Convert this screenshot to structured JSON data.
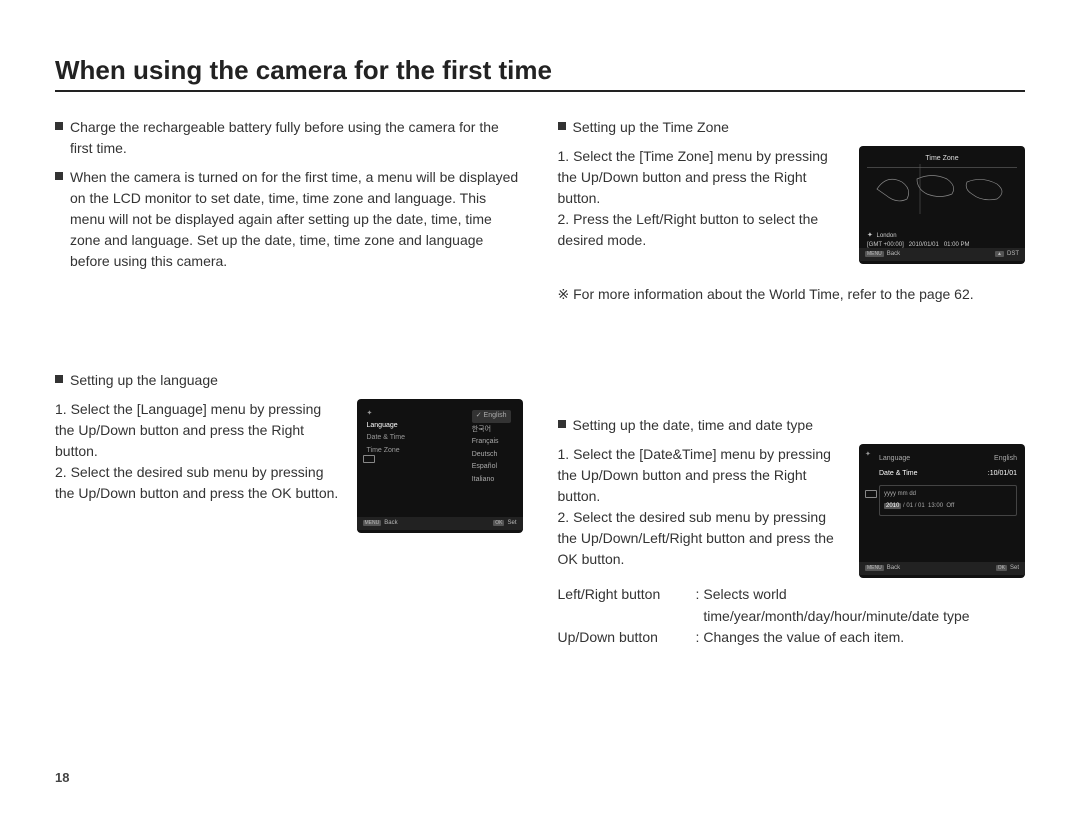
{
  "title": "When using the camera for the first time",
  "pageNumber": "18",
  "left": {
    "bullet1": "Charge the rechargeable battery fully before using the camera for the first time.",
    "bullet2": "When the camera is turned on for the first time, a menu will be displayed on the LCD monitor to set date, time, time zone and language. This menu will not be displayed again after setting up the date, time, time zone and language. Set up the date, time, time zone and language before using this camera.",
    "langSection": {
      "heading": "Setting up the language",
      "step1": "1. Select the [Language] menu by pressing the Up/Down button and press the Right button.",
      "step2": "2. Select the desired sub menu by pressing the Up/Down button and press the OK button.",
      "screen": {
        "menuItems": [
          "Language",
          "Date & Time",
          "Time Zone"
        ],
        "options": [
          "English",
          "한국어",
          "Français",
          "Deutsch",
          "Español",
          "Italiano"
        ],
        "footerLeft": "Back",
        "footerLeftBtn": "MENU",
        "footerRight": "Set",
        "footerRightBtn": "OK"
      }
    }
  },
  "right": {
    "tzSection": {
      "heading": "Setting up the Time Zone",
      "step1": "1. Select the [Time Zone] menu by pressing the Up/Down button and press the Right button.",
      "step2": "2. Press the Left/Right button to select the desired mode.",
      "screen": {
        "title": "Time Zone",
        "city": "London",
        "gmt": "[GMT +00:00]",
        "date": "2010/01/01",
        "time": "01:00 PM",
        "footerLeft": "Back",
        "footerLeftBtn": "MENU",
        "footerRight": "DST"
      },
      "note": "※ For more information about the World Time, refer to the page 62."
    },
    "dtSection": {
      "heading": "Setting up the date, time and date type",
      "step1": "1. Select the [Date&Time] menu by pressing the Up/Down button and press the Right button.",
      "step2": "2. Select the desired sub menu by pressing the Up/Down/Left/Right button and press the OK button.",
      "screen": {
        "row1Label": "Language",
        "row1Value": "English",
        "row2Label": "Date & Time",
        "row2Value": ":10/01/01",
        "format": "yyyy mm dd",
        "values": "2010 / 01 / 01  13:00  Off",
        "highlight": "2010",
        "footerLeft": "Back",
        "footerLeftBtn": "MENU",
        "footerRight": "Set",
        "footerRightBtn": "OK"
      },
      "notes": {
        "row1Label": "Left/Right button",
        "row1Text": "Selects world time/year/month/day/hour/minute/date type",
        "row2Label": "Up/Down button",
        "row2Text": "Changes the value of each item."
      }
    }
  }
}
